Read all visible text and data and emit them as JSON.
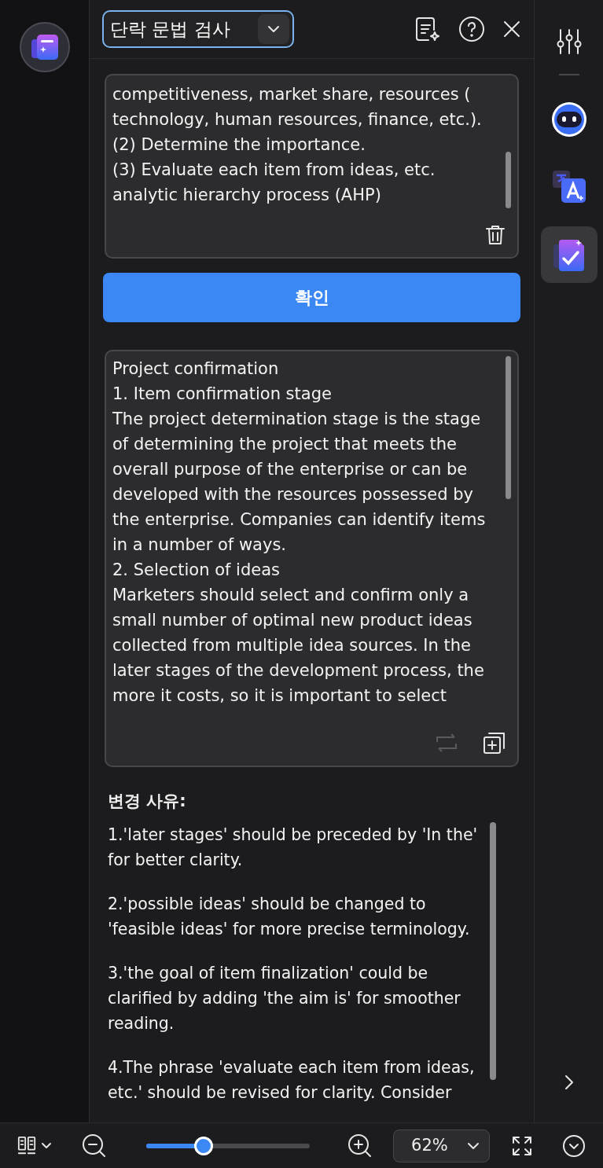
{
  "header": {
    "mode_select": "단락 문법 검사"
  },
  "input_box": {
    "lines": [
      "competitiveness, market share, resources (",
      "technology, human resources, finance, etc.).",
      "(2) Determine the importance.",
      "(3) Evaluate each item from ideas, etc.",
      "analytic hierarchy process (AHP)"
    ]
  },
  "confirm_button": "확인",
  "result_box": {
    "lines": [
      "Project confirmation",
      "1. Item confirmation stage",
      "The project determination stage is the stage",
      "of determining the project that meets the",
      "overall purpose of the enterprise or can be",
      "developed with the resources possessed by",
      "the enterprise. Companies can identify items",
      "in a number of ways.",
      "2. Selection of ideas",
      "Marketers should select and confirm only a",
      "small number of optimal new product ideas",
      "collected from multiple idea sources. In the",
      "later stages of the development process, the",
      "more it costs, so it is important to select"
    ],
    "replace_disabled": true
  },
  "reasons": {
    "title": "변경 사유:",
    "items": [
      "1.'later stages' should be preceded by 'In the' for better clarity.",
      "2.'possible ideas' should be changed to 'feasible ideas' for more precise terminology.",
      "3.'the goal of item finalization' could be clarified by adding 'the aim is' for smoother reading.",
      "4.The phrase 'evaluate each item from ideas, etc.' should be revised for clarity. Consider"
    ]
  },
  "right_rail": [
    {
      "kind": "settings",
      "selected": false
    },
    {
      "kind": "bot",
      "selected": false
    },
    {
      "kind": "translate",
      "selected": false
    },
    {
      "kind": "grammar",
      "selected": true
    }
  ],
  "bottom_bar": {
    "zoom": {
      "level": 0.35
    },
    "zoom_value": "62%"
  }
}
